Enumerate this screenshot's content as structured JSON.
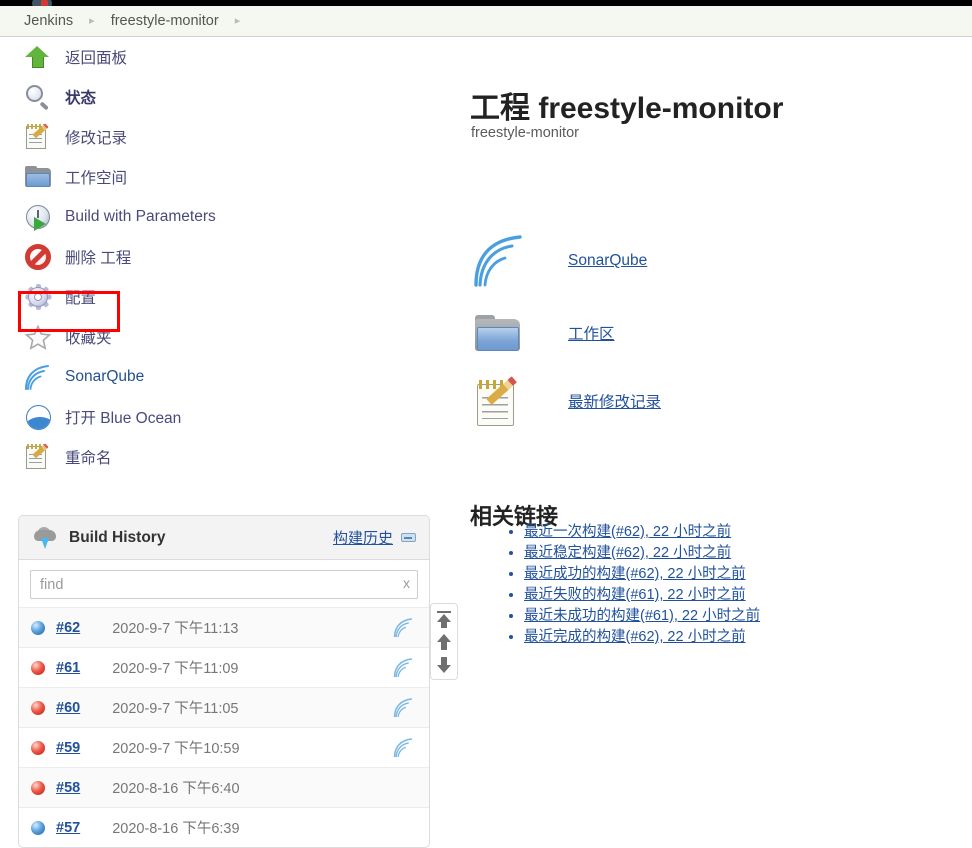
{
  "breadcrumb": {
    "items": [
      "Jenkins",
      "freestyle-monitor"
    ],
    "separator": "▸"
  },
  "sidebar": {
    "tasks": [
      {
        "label": "返回面板",
        "icon": "up-arrow-icon",
        "style": "link"
      },
      {
        "label": "状态",
        "icon": "magnifier-icon",
        "style": "bold"
      },
      {
        "label": "修改记录",
        "icon": "notepad-pencil-icon",
        "style": "link"
      },
      {
        "label": "工作空间",
        "icon": "folder-icon",
        "style": "link"
      },
      {
        "label": "Build with Parameters",
        "icon": "clock-play-icon",
        "style": "link"
      },
      {
        "label": "删除 工程",
        "icon": "forbidden-icon",
        "style": "link"
      },
      {
        "label": "配置",
        "icon": "gear-icon",
        "style": "link"
      },
      {
        "label": "收藏夹",
        "icon": "star-icon",
        "style": "link"
      },
      {
        "label": "SonarQube",
        "icon": "sonar-waves-icon",
        "style": "blue"
      },
      {
        "label": "打开 Blue Ocean",
        "icon": "blue-ocean-icon",
        "style": "link"
      },
      {
        "label": "重命名",
        "icon": "notepad-pencil-icon",
        "style": "link"
      }
    ],
    "highlighted_task": "配置"
  },
  "build_history": {
    "title": "Build History",
    "link_label": "构建历史",
    "collapse_icon": "collapse-icon",
    "weather_icon": "cloud-lightning-icon",
    "find": {
      "value": "",
      "placeholder": "find",
      "clear_label": "x"
    },
    "scroll_controls": [
      {
        "name": "scroll-to-top-button",
        "icon": "arrow-to-top-icon"
      },
      {
        "name": "scroll-up-button",
        "icon": "arrow-up-icon"
      },
      {
        "name": "scroll-down-button",
        "icon": "arrow-down-icon"
      }
    ],
    "rows": [
      {
        "status": "blue",
        "number": "#62",
        "date": "2020-9-7 下午11:13",
        "sonar": true
      },
      {
        "status": "red",
        "number": "#61",
        "date": "2020-9-7 下午11:09",
        "sonar": true
      },
      {
        "status": "red",
        "number": "#60",
        "date": "2020-9-7 下午11:05",
        "sonar": true
      },
      {
        "status": "red",
        "number": "#59",
        "date": "2020-9-7 下午10:59",
        "sonar": true
      },
      {
        "status": "red",
        "number": "#58",
        "date": "2020-8-16 下午6:40",
        "sonar": false
      },
      {
        "status": "blue",
        "number": "#57",
        "date": "2020-8-16 下午6:39",
        "sonar": false
      }
    ]
  },
  "main": {
    "title": "工程 freestyle-monitor",
    "description": "freestyle-monitor",
    "actions": [
      {
        "label": "SonarQube",
        "icon": "sonar-waves-icon"
      },
      {
        "label": "工作区",
        "icon": "folder-icon"
      },
      {
        "label": "最新修改记录",
        "icon": "notepad-pencil-icon"
      }
    ],
    "related": {
      "heading": "相关链接",
      "links": [
        "最近一次构建(#62), 22 小时之前",
        "最近稳定构建(#62), 22 小时之前",
        "最近成功的构建(#62), 22 小时之前",
        "最近失败的构建(#61), 22 小时之前",
        "最近未成功的构建(#61), 22 小时之前",
        "最近完成的构建(#62), 22 小时之前"
      ]
    }
  },
  "colors": {
    "accent_link": "#22529c",
    "sidebar_link": "#4a4a7a",
    "highlight_box": "#ff0000",
    "breadcrumb_bg": "#f5f8f0",
    "topbar_bg": "#000000",
    "status_success": "#1f5f9e",
    "status_failure": "#b41d12"
  }
}
